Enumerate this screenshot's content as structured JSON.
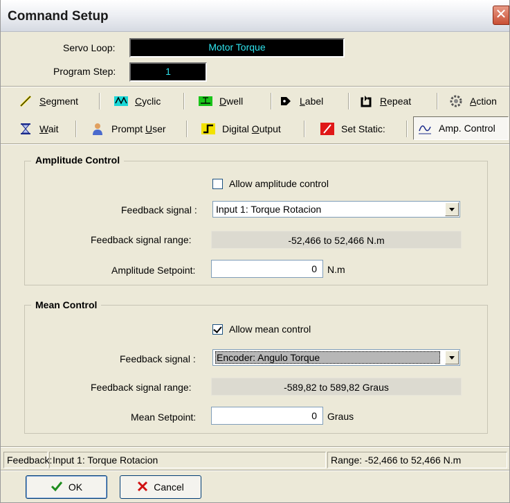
{
  "window": {
    "title": "Comnand Setup",
    "close_glyph": "✕"
  },
  "header": {
    "servo_loop_label": "Servo Loop:",
    "servo_loop_value": "Motor Torque",
    "program_step_label": "Program Step:",
    "program_step_value": "1"
  },
  "toolbar": {
    "row1": [
      {
        "key": "S",
        "rest": "egment",
        "icon": "segment-icon"
      },
      {
        "key": "C",
        "rest": "yclic",
        "icon": "cyclic-icon"
      },
      {
        "key": "D",
        "rest": "well",
        "icon": "dwell-icon"
      },
      {
        "key": "L",
        "rest": "abel",
        "icon": "label-icon"
      },
      {
        "key": "R",
        "rest": "epeat",
        "icon": "repeat-icon"
      },
      {
        "key": "A",
        "rest": "ction",
        "icon": "action-icon"
      }
    ],
    "row2": [
      {
        "key": "W",
        "rest": "ait",
        "icon": "wait-icon"
      },
      {
        "pre": "Prompt ",
        "key": "U",
        "rest": "ser",
        "icon": "prompt-user-icon"
      },
      {
        "pre": "Digital ",
        "key": "O",
        "rest": "utput",
        "icon": "digital-output-icon"
      },
      {
        "label": "Set Static:",
        "icon": "set-static-icon"
      },
      {
        "label": "Amp. Control",
        "icon": "amp-control-icon",
        "active": true
      }
    ]
  },
  "amplitude_control": {
    "title": "Amplitude Control",
    "allow_label": "Allow amplitude control",
    "allow_checked": false,
    "feedback_signal_label": "Feedback signal :",
    "feedback_signal_value": "Input 1: Torque Rotacion",
    "range_label": "Feedback signal range:",
    "range_value": "-52,466 to 52,466 N.m",
    "setpoint_label": "Amplitude Setpoint:",
    "setpoint_value": "0",
    "setpoint_unit": "N.m"
  },
  "mean_control": {
    "title": "Mean Control",
    "allow_label": "Allow mean control",
    "allow_checked": true,
    "feedback_signal_label": "Feedback signal :",
    "feedback_signal_value": "Encoder: Angulo Torque",
    "range_label": "Feedback signal range:",
    "range_value": "-589,82 to 589,82 Graus",
    "setpoint_label": "Mean Setpoint:",
    "setpoint_value": "0",
    "setpoint_unit": "Graus"
  },
  "status": {
    "feedback_label": "Feedback:",
    "feedback_value": "Input 1: Torque Rotacion",
    "range_value": "Range: -52,466 to 52,466 N.m"
  },
  "buttons": {
    "ok": "OK",
    "cancel": "Cancel"
  }
}
